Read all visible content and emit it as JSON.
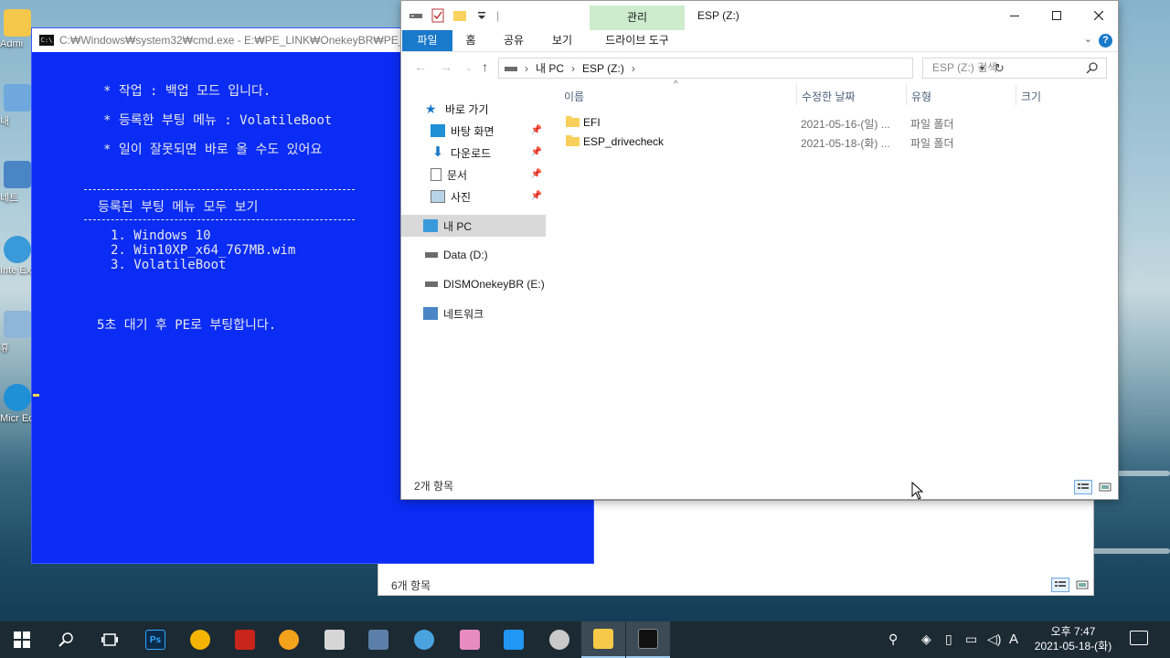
{
  "desktop": {
    "icons": [
      {
        "label": "Admi",
        "icon": "folder-icon"
      },
      {
        "label": "내",
        "icon": "pc-icon"
      },
      {
        "label": "네트",
        "icon": "network-icon"
      },
      {
        "label": "Inte Exp",
        "icon": "ie-icon"
      },
      {
        "label": "휴",
        "icon": "recycle-icon"
      },
      {
        "label": "Micr Ec",
        "icon": "edge-icon"
      }
    ]
  },
  "cmd": {
    "title": "C:₩Windows₩system32₩cmd.exe - E:₩PE_LINK₩OnekeyBR₩PE_Bk.cm",
    "lines": [
      "* 작업 : 백업 모드 입니다.",
      "* 등록한 부팅 메뉴 : VolatileBoot",
      "* 일이 잘못되면 바로 올 수도 있어요"
    ],
    "section_title": "등록된 부팅 메뉴 모두 보기",
    "menu": [
      "1. Windows 10",
      "2. Win10XP_x64_767MB.wim",
      "3. VolatileBoot"
    ],
    "footer": "5초 대기 후 PE로 부팅합니다."
  },
  "explorer": {
    "title": "ESP (Z:)",
    "context_tab": "관리",
    "tabs": {
      "file": "파일",
      "home": "홈",
      "share": "공유",
      "view": "보기",
      "drive_tools": "드라이브 도구"
    },
    "address": {
      "crumbs": [
        "내 PC",
        "ESP (Z:)"
      ]
    },
    "search_placeholder": "ESP (Z:) 검색",
    "nav": {
      "quick_access": "바로 가기",
      "desktop": "바탕 화면",
      "downloads": "다운로드",
      "documents": "문서",
      "pictures": "사진",
      "this_pc": "내 PC",
      "data_drive": "Data (D:)",
      "dism_drive": "DISMOnekeyBR (E:)",
      "network": "네트워크"
    },
    "columns": {
      "name": "이름",
      "date": "수정한 날짜",
      "type": "유형",
      "size": "크기"
    },
    "files": [
      {
        "name": "EFI",
        "date": "2021-05-16-(일) ...",
        "type": "파일 폴더"
      },
      {
        "name": "ESP_drivecheck",
        "date": "2021-05-18-(화) ...",
        "type": "파일 폴더"
      }
    ],
    "status": "2개 항목"
  },
  "bg_explorer": {
    "status": "6개 항목"
  },
  "taskbar": {
    "items": [
      {
        "name": "start-button",
        "icon": "windows-logo-icon"
      },
      {
        "name": "search-button",
        "icon": "search-icon"
      },
      {
        "name": "task-view-button",
        "icon": "task-view-icon"
      },
      {
        "name": "photoshop",
        "label": "Ps",
        "color": "#0a2a4a"
      },
      {
        "name": "app-warning",
        "color": "#f5b400"
      },
      {
        "name": "app-pdf",
        "color": "#c8241a"
      },
      {
        "name": "app-search",
        "color": "#f3a21c"
      },
      {
        "name": "app-disk",
        "color": "#d6d6d6"
      },
      {
        "name": "app-user",
        "color": "#5b7fa8"
      },
      {
        "name": "app-network",
        "color": "#4aa3df"
      },
      {
        "name": "app-pink",
        "color": "#e88bc2"
      },
      {
        "name": "app-remote",
        "color": "#2196f3"
      },
      {
        "name": "app-dvd",
        "color": "#c9c9c9"
      },
      {
        "name": "file-explorer",
        "color": "#f7c948"
      },
      {
        "name": "cmd",
        "color": "#111111"
      }
    ],
    "ime": "A",
    "time": "오후 7:47",
    "date": "2021-05-18-(화)"
  }
}
